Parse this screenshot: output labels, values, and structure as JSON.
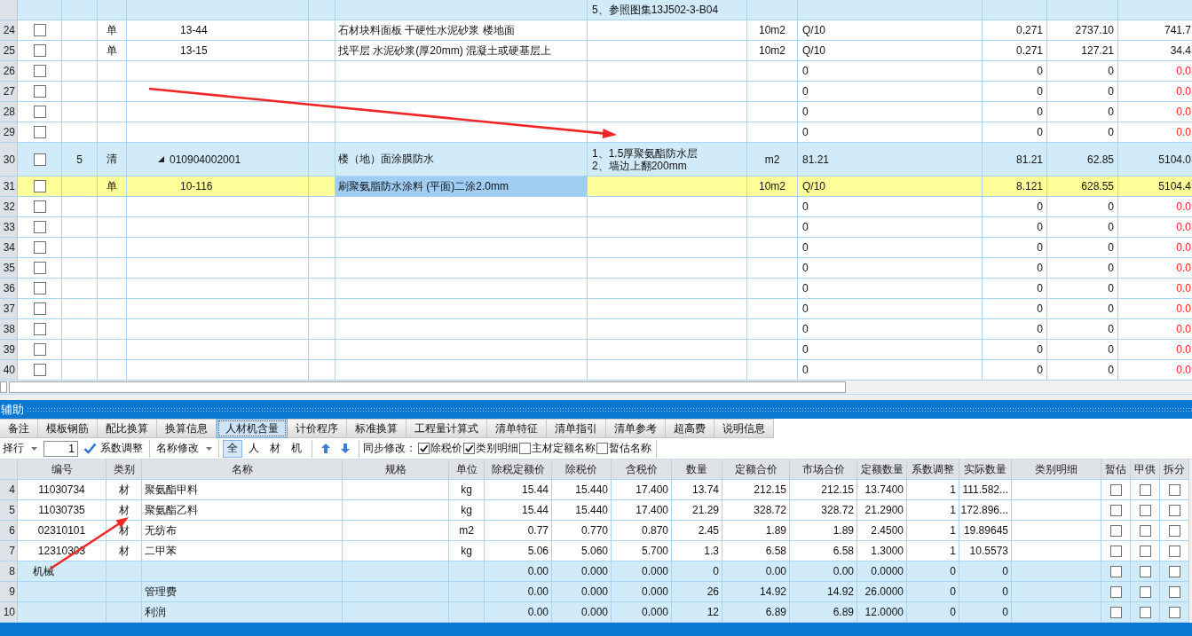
{
  "upper_grid": {
    "rows": [
      {
        "kind": "bill",
        "selected": false,
        "features": [
          "5、参照图集13J502-3-B04"
        ],
        "children": [
          {
            "kind": "item",
            "selected": false,
            "row_no": "24",
            "checked": false,
            "type": "单",
            "code": "13-44",
            "name": "石材块料面板 干硬性水泥砂浆 楼地面",
            "unit": "10m2",
            "qty_expr": "Q/10",
            "qty": "0.271",
            "price": "2737.10",
            "total": "741.7",
            "total_alert": false
          },
          {
            "kind": "item",
            "selected": false,
            "row_no": "25",
            "checked": false,
            "type": "单",
            "code": "13-15",
            "name": "找平层 水泥砂浆(厚20mm) 混凝土或硬基层上",
            "unit": "10m2",
            "qty_expr": "Q/10",
            "qty": "0.271",
            "price": "127.21",
            "total": "34.4",
            "total_alert": false
          },
          {
            "kind": "item",
            "selected": false,
            "row_no": "26",
            "checked": false,
            "qty_expr": "0",
            "qty": "0",
            "price": "0",
            "total": "0.0",
            "total_alert": true
          },
          {
            "kind": "item",
            "selected": false,
            "row_no": "27",
            "checked": false,
            "qty_expr": "0",
            "qty": "0",
            "price": "0",
            "total": "0.0",
            "total_alert": true
          },
          {
            "kind": "item",
            "selected": false,
            "row_no": "28",
            "checked": false,
            "qty_expr": "0",
            "qty": "0",
            "price": "0",
            "total": "0.0",
            "total_alert": true
          },
          {
            "kind": "item",
            "selected": false,
            "row_no": "29",
            "checked": false,
            "qty_expr": "0",
            "qty": "0",
            "price": "0",
            "total": "0.0",
            "total_alert": true
          }
        ]
      },
      {
        "kind": "bill",
        "selected": false,
        "row_no": "30",
        "checked": false,
        "index": "5",
        "type": "清",
        "expanded": true,
        "code": "010904002001",
        "name": "楼（地）面涂膜防水",
        "features": [
          "1、1.5厚聚氨酯防水层",
          "2、墙边上翻200mm"
        ],
        "unit": "m2",
        "qty_expr": "81.21",
        "qty": "81.21",
        "price": "62.85",
        "total": "5104.0",
        "total_alert": false,
        "children": [
          {
            "kind": "item",
            "selected": true,
            "row_no": "31",
            "checked": false,
            "type": "单",
            "code": "10-116",
            "name": "刷聚氨脂防水涂料 (平面)二涂2.0mm",
            "unit": "10m2",
            "qty_expr": "Q/10",
            "qty": "8.121",
            "price": "628.55",
            "total": "5104.4",
            "total_alert": false
          },
          {
            "kind": "item",
            "selected": false,
            "row_no": "32",
            "checked": false,
            "qty_expr": "0",
            "qty": "0",
            "price": "0",
            "total": "0.0",
            "total_alert": true
          },
          {
            "kind": "item",
            "selected": false,
            "row_no": "33",
            "checked": false,
            "qty_expr": "0",
            "qty": "0",
            "price": "0",
            "total": "0.0",
            "total_alert": true
          },
          {
            "kind": "item",
            "selected": false,
            "row_no": "34",
            "checked": false,
            "qty_expr": "0",
            "qty": "0",
            "price": "0",
            "total": "0.0",
            "total_alert": true
          },
          {
            "kind": "item",
            "selected": false,
            "row_no": "35",
            "checked": false,
            "qty_expr": "0",
            "qty": "0",
            "price": "0",
            "total": "0.0",
            "total_alert": true
          },
          {
            "kind": "item",
            "selected": false,
            "row_no": "36",
            "checked": false,
            "qty_expr": "0",
            "qty": "0",
            "price": "0",
            "total": "0.0",
            "total_alert": true
          },
          {
            "kind": "item",
            "selected": false,
            "row_no": "37",
            "checked": false,
            "qty_expr": "0",
            "qty": "0",
            "price": "0",
            "total": "0.0",
            "total_alert": true
          },
          {
            "kind": "item",
            "selected": false,
            "row_no": "38",
            "checked": false,
            "qty_expr": "0",
            "qty": "0",
            "price": "0",
            "total": "0.0",
            "total_alert": true
          },
          {
            "kind": "item",
            "selected": false,
            "row_no": "39",
            "checked": false,
            "qty_expr": "0",
            "qty": "0",
            "price": "0",
            "total": "0.0",
            "total_alert": true
          },
          {
            "kind": "item",
            "selected": false,
            "row_no": "40",
            "checked": false,
            "qty_expr": "0",
            "qty": "0",
            "price": "0",
            "total": "0.0",
            "total_alert": true
          }
        ]
      }
    ]
  },
  "detail_panel": {
    "title": "辅助",
    "tabs": [
      {
        "label": "备注",
        "selected": false
      },
      {
        "label": "模板钢筋",
        "selected": false
      },
      {
        "label": "配比换算",
        "selected": false
      },
      {
        "label": "换算信息",
        "selected": false
      },
      {
        "label": "人材机含量",
        "selected": true
      },
      {
        "label": "计价程序",
        "selected": false
      },
      {
        "label": "标准换算",
        "selected": false
      },
      {
        "label": "工程量计算式",
        "selected": false
      },
      {
        "label": "清单特征",
        "selected": false
      },
      {
        "label": "清单指引",
        "selected": false
      },
      {
        "label": "清单参考",
        "selected": false
      },
      {
        "label": "超高费",
        "selected": false
      },
      {
        "label": "说明信息",
        "selected": false
      }
    ],
    "toolbar": {
      "row_selector": "择行",
      "row_count": "1",
      "coefficient_button": "系数调整",
      "rename_menu": "名称修改",
      "filters": [
        {
          "label": "全",
          "selected": true
        },
        {
          "label": "人",
          "selected": false
        },
        {
          "label": "材",
          "selected": false
        },
        {
          "label": "机",
          "selected": false
        }
      ],
      "sync_label": "同步修改：",
      "sync_options": [
        {
          "label": "除税价",
          "checked": true
        },
        {
          "label": "类别明细",
          "checked": true
        },
        {
          "label": "主材定额名称",
          "checked": false
        },
        {
          "label": "暂估名称",
          "checked": false
        }
      ]
    },
    "grid": {
      "columns": [
        "编号",
        "类别",
        "名称",
        "规格",
        "单位",
        "除税定额价",
        "除税价",
        "含税价",
        "数量",
        "定额合价",
        "市场合价",
        "定额数量",
        "系数调整",
        "实际数量",
        "类别明细",
        "暂估",
        "甲供",
        "拆分"
      ],
      "rows": [
        {
          "row_no": "4",
          "kind": "material",
          "code": "11030734",
          "category": "材",
          "name": "聚氨酯甲料",
          "unit": "kg",
          "quota_price_ex_tax": "15.44",
          "price_ex_tax": "15.440",
          "price_incl_tax": "17.400",
          "quantity": "13.74",
          "quota_total": "212.15",
          "market_total": "212.15",
          "quota_quantity": "13.7400",
          "coefficient": "1",
          "actual_quantity": "111.582...",
          "provisional": false,
          "owner_supplied": false,
          "split": false
        },
        {
          "row_no": "5",
          "kind": "material",
          "code": "11030735",
          "category": "材",
          "name": "聚氨酯乙料",
          "unit": "kg",
          "quota_price_ex_tax": "15.44",
          "price_ex_tax": "15.440",
          "price_incl_tax": "17.400",
          "quantity": "21.29",
          "quota_total": "328.72",
          "market_total": "328.72",
          "quota_quantity": "21.2900",
          "coefficient": "1",
          "actual_quantity": "172.896...",
          "provisional": false,
          "owner_supplied": false,
          "split": false
        },
        {
          "row_no": "6",
          "kind": "material",
          "code": "02310101",
          "category": "材",
          "name": "无纺布",
          "unit": "m2",
          "quota_price_ex_tax": "0.77",
          "price_ex_tax": "0.770",
          "price_incl_tax": "0.870",
          "quantity": "2.45",
          "quota_total": "1.89",
          "market_total": "1.89",
          "quota_quantity": "2.4500",
          "coefficient": "1",
          "actual_quantity": "19.89645",
          "provisional": false,
          "owner_supplied": false,
          "split": false
        },
        {
          "row_no": "7",
          "kind": "material",
          "code": "12310303",
          "category": "材",
          "name": "二甲苯",
          "unit": "kg",
          "quota_price_ex_tax": "5.06",
          "price_ex_tax": "5.060",
          "price_incl_tax": "5.700",
          "quantity": "1.3",
          "quota_total": "6.58",
          "market_total": "6.58",
          "quota_quantity": "1.3000",
          "coefficient": "1",
          "actual_quantity": "10.5573",
          "provisional": false,
          "owner_supplied": false,
          "split": false
        },
        {
          "row_no": "8",
          "kind": "group",
          "code": "机械",
          "quota_price_ex_tax": "0.00",
          "price_ex_tax": "0.000",
          "price_incl_tax": "0.000",
          "quantity": "0",
          "quota_total": "0.00",
          "market_total": "0.00",
          "quota_quantity": "0.0000",
          "coefficient": "0",
          "actual_quantity": "0",
          "provisional": false,
          "owner_supplied": false,
          "split": false
        },
        {
          "row_no": "9",
          "kind": "fee",
          "name": "管理费",
          "quota_price_ex_tax": "0.00",
          "price_ex_tax": "0.000",
          "price_incl_tax": "0.000",
          "quantity": "26",
          "quota_total": "14.92",
          "market_total": "14.92",
          "quota_quantity": "26.0000",
          "coefficient": "0",
          "actual_quantity": "0",
          "provisional": false,
          "owner_supplied": false,
          "split": false
        },
        {
          "row_no": "10",
          "kind": "fee",
          "name": "利润",
          "quota_price_ex_tax": "0.00",
          "price_ex_tax": "0.000",
          "price_incl_tax": "0.000",
          "quantity": "12",
          "quota_total": "6.89",
          "market_total": "6.89",
          "quota_quantity": "12.0000",
          "coefficient": "0",
          "actual_quantity": "0",
          "provisional": false,
          "owner_supplied": false,
          "split": false
        }
      ]
    }
  }
}
